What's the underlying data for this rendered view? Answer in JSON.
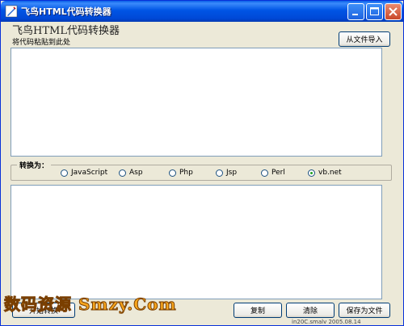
{
  "window": {
    "title": "飞鸟HTML代码转换器"
  },
  "header": {
    "title": "飞鸟HTML代码转换器",
    "paste_label": "将代码粘贴到此处"
  },
  "toolbar": {
    "import_label": "从文件导入"
  },
  "input_area": {
    "value": ""
  },
  "convert": {
    "group_label": "转换为：",
    "options": [
      "JavaScript",
      "Asp",
      "Php",
      "Jsp",
      "Perl",
      "vb.net"
    ],
    "selected": "vb.net"
  },
  "output_area": {
    "value": ""
  },
  "actions": {
    "start_label": "开始转换",
    "copy_label": "复制",
    "clear_label": "清除",
    "save_label": "保存为文件"
  },
  "status": {
    "text": "in20C.smalv 2005.08.14"
  },
  "watermark": {
    "text": "数码资源 Smzy.Com"
  },
  "colors": {
    "titlebar": "#0055e5",
    "accent_border": "#003c74",
    "watermark": "#f7a51c"
  }
}
